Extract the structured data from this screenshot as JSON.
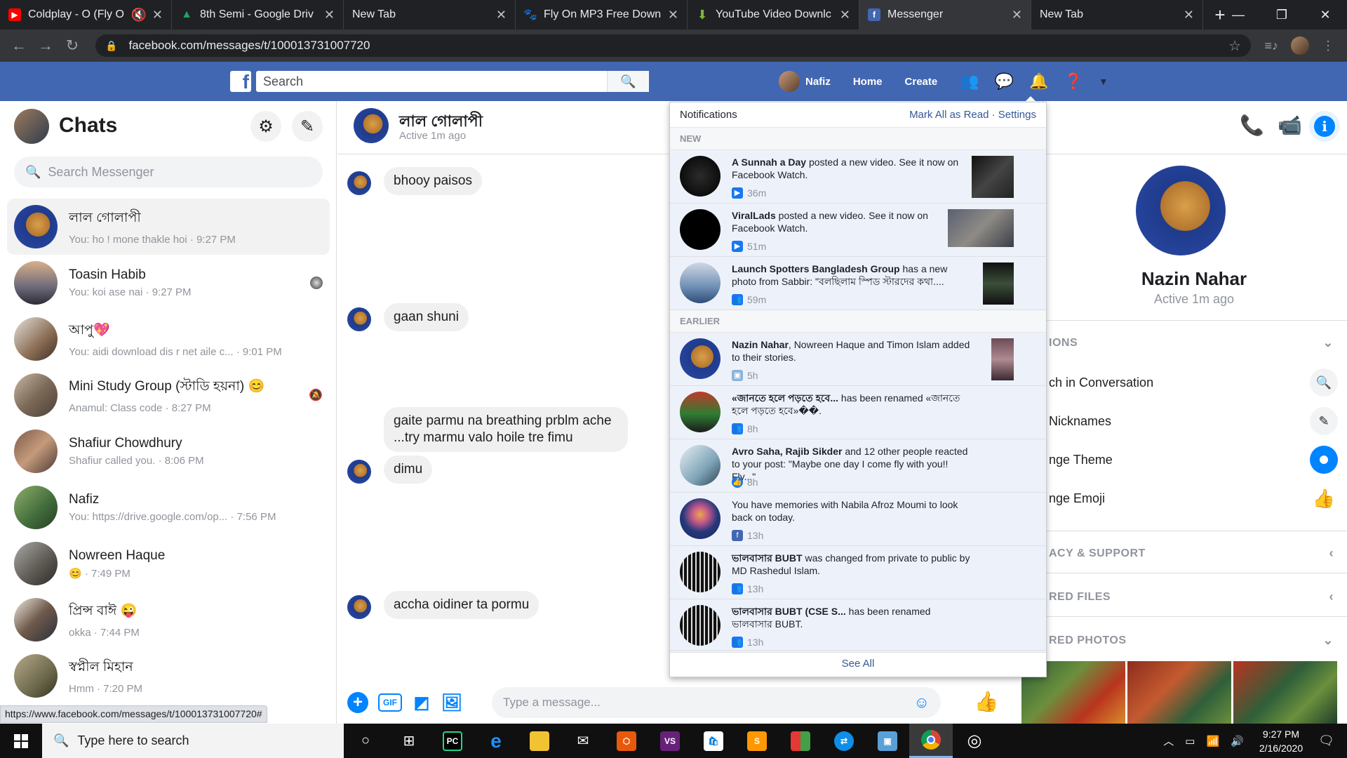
{
  "browser": {
    "tabs": [
      {
        "title": "Coldplay - O (Fly O",
        "favicon": "youtube-icon",
        "color": "#ff0000",
        "muted": true
      },
      {
        "title": "8th Semi - Google Driv",
        "favicon": "google-drive-icon",
        "color": "#1fa463"
      },
      {
        "title": "New Tab",
        "favicon": "",
        "color": ""
      },
      {
        "title": "Fly On MP3 Free Down",
        "favicon": "paw-icon",
        "color": "#c45c26"
      },
      {
        "title": "YouTube Video Downlc",
        "favicon": "download-arrow-icon",
        "color": "#7cb342"
      },
      {
        "title": "Messenger",
        "favicon": "facebook-icon",
        "color": "#4267b2",
        "active": true
      },
      {
        "title": "New Tab",
        "favicon": "",
        "color": ""
      }
    ],
    "url": "facebook.com/messages/t/100013731007720",
    "status_url": "https://www.facebook.com/messages/t/100013731007720#"
  },
  "fb_header": {
    "search_placeholder": "Search",
    "profile_name": "Nafiz",
    "home": "Home",
    "create": "Create"
  },
  "chats": {
    "title": "Chats",
    "search_placeholder": "Search Messenger",
    "list": [
      {
        "name": "লাল গোলাপী",
        "preview": "You: ho ! mone thakle hoi · 9:27 PM",
        "selected": true
      },
      {
        "name": "Toasin Habib",
        "preview": "You: koi ase nai · 9:27 PM"
      },
      {
        "name": "আপু💖",
        "preview": "You: aidi download dis r net aile c... · 9:01 PM"
      },
      {
        "name": "Mini Study Group (স্টাডি হয়না) 😊",
        "preview": "Anamul: Class code · 8:27 PM",
        "muted": true
      },
      {
        "name": "Shafiur Chowdhury",
        "preview": "Shafiur called you. · 8:06 PM"
      },
      {
        "name": "Nafiz",
        "preview": "You: https://drive.google.com/op... · 7:56 PM"
      },
      {
        "name": "Nowreen Haque",
        "preview": "😊 · 7:49 PM"
      },
      {
        "name": "প্রিন্স বাঈ 😜",
        "preview": "okka · 7:44 PM"
      },
      {
        "name": "স্বপ্নীল মিহান",
        "preview": "Hmm · 7:20 PM"
      }
    ]
  },
  "conversation": {
    "name": "লাল গোলাপী",
    "status": "Active 1m ago",
    "messages": [
      {
        "text": "bhooy paisos"
      },
      {
        "text": "gaan shuni"
      },
      {
        "text": "gaite parmu na breathing  prblm ache ...try marmu valo hoile  tre  fimu"
      },
      {
        "text": "dimu"
      },
      {
        "text": "accha oidiner ta pormu"
      }
    ],
    "composer_placeholder": "Type a message..."
  },
  "info_panel": {
    "name": "Nazin Nahar",
    "status": "Active 1m ago",
    "options_header": "IONS",
    "rows": [
      "ch in Conversation",
      "Nicknames",
      "nge Theme",
      "nge Emoji"
    ],
    "privacy_header": "ACY & SUPPORT",
    "files_header": "RED FILES",
    "photos_header": "RED PHOTOS"
  },
  "notifications": {
    "title": "Notifications",
    "mark_all": "Mark All as Read",
    "separator": "·",
    "settings": "Settings",
    "new_label": "NEW",
    "earlier_label": "EARLIER",
    "new_items": [
      {
        "bold": "A Sunnah a Day",
        "text": " posted a new video. See it now on Facebook Watch.",
        "time": "36m",
        "type": "video"
      },
      {
        "bold": "ViralLads",
        "text": " posted a new video. See it now on Facebook Watch.",
        "time": "51m",
        "type": "video"
      },
      {
        "bold": "Launch Spotters Bangladesh Group",
        "text": " has a new photo from Sabbir: \"বলছিলাম স্পিড স্টারদের কথা....",
        "time": "59m",
        "type": "group"
      }
    ],
    "earlier_items": [
      {
        "bold": "Nazin Nahar",
        "text": ", Nowreen Haque and Timon Islam added to their stories.",
        "time": "5h",
        "type": "photo"
      },
      {
        "bold": "«জানতে হলে পড়তে হবে...",
        "text": " has been renamed «জানতে হলে পড়তে হবে»��.",
        "time": "8h",
        "type": "group"
      },
      {
        "bold": "Avro Saha, Rajib Sikder",
        "text": " and 12 other people reacted to your post: \"Maybe one day I come fly with you!! Fly...\"",
        "time": "8h",
        "type": "like"
      },
      {
        "bold": "",
        "text": "You have memories with Nabila Afroz Moumi to look back on today.",
        "time": "13h",
        "type": "facebook"
      },
      {
        "bold": "ভালবাসার BUBT",
        "text": " was changed from private to public by MD Rashedul Islam.",
        "time": "13h",
        "type": "group"
      },
      {
        "bold": "ভালবাসার BUBT (CSE S...",
        "text": " has been renamed ভালবাসার BUBT.",
        "time": "13h",
        "type": "group"
      }
    ],
    "see_all": "See All"
  },
  "taskbar": {
    "search_placeholder": "Type here to search",
    "time": "9:27 PM",
    "date": "2/16/2020"
  }
}
